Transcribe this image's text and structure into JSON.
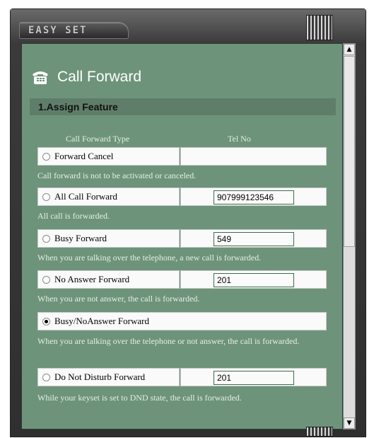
{
  "window": {
    "title": "EASY SET"
  },
  "header": {
    "title": "Call Forward",
    "icon": "phone-icon"
  },
  "section": {
    "title": "1.Assign Feature"
  },
  "columns": {
    "type": "Call Forward Type",
    "tel": "Tel No"
  },
  "rows": [
    {
      "label": "Forward Cancel",
      "selected": false,
      "tel": "",
      "desc": "Call forward is not to be activated or canceled."
    },
    {
      "label": "All Call Forward",
      "selected": false,
      "tel": "907999123546",
      "desc": "All call is forwarded."
    },
    {
      "label": "Busy Forward",
      "selected": false,
      "tel": "549",
      "desc": "When you are talking over the telephone, a new call is forwarded."
    },
    {
      "label": "No Answer Forward",
      "selected": false,
      "tel": "201",
      "desc": "When you are not answer, the call is forwarded."
    },
    {
      "label": "Busy/NoAnswer Forward",
      "selected": true,
      "tel": "",
      "desc": "When you are talking over the telephone or not answer, the call is forwarded."
    },
    {
      "label": "Do Not Disturb Forward",
      "selected": false,
      "tel": "201",
      "desc": "While your keyset is set to DND state, the call is forwarded."
    }
  ],
  "colors": {
    "panel": "#6d947a",
    "frame": "#3b3b3b",
    "section": "#5f7e6a"
  }
}
